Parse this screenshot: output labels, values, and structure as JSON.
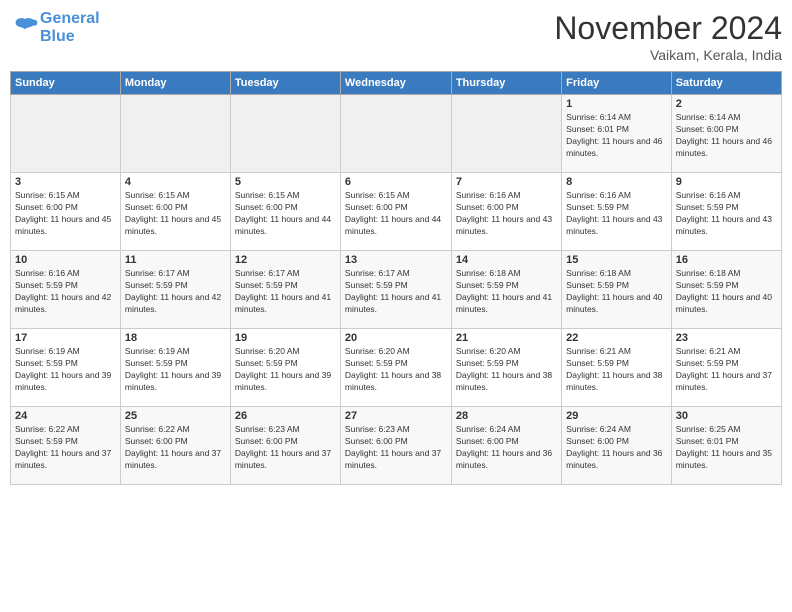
{
  "header": {
    "logo_general": "General",
    "logo_blue": "Blue",
    "title": "November 2024",
    "location": "Vaikam, Kerala, India"
  },
  "days_of_week": [
    "Sunday",
    "Monday",
    "Tuesday",
    "Wednesday",
    "Thursday",
    "Friday",
    "Saturday"
  ],
  "weeks": [
    [
      {
        "day": "",
        "info": ""
      },
      {
        "day": "",
        "info": ""
      },
      {
        "day": "",
        "info": ""
      },
      {
        "day": "",
        "info": ""
      },
      {
        "day": "",
        "info": ""
      },
      {
        "day": "1",
        "info": "Sunrise: 6:14 AM\nSunset: 6:01 PM\nDaylight: 11 hours and 46 minutes."
      },
      {
        "day": "2",
        "info": "Sunrise: 6:14 AM\nSunset: 6:00 PM\nDaylight: 11 hours and 46 minutes."
      }
    ],
    [
      {
        "day": "3",
        "info": "Sunrise: 6:15 AM\nSunset: 6:00 PM\nDaylight: 11 hours and 45 minutes."
      },
      {
        "day": "4",
        "info": "Sunrise: 6:15 AM\nSunset: 6:00 PM\nDaylight: 11 hours and 45 minutes."
      },
      {
        "day": "5",
        "info": "Sunrise: 6:15 AM\nSunset: 6:00 PM\nDaylight: 11 hours and 44 minutes."
      },
      {
        "day": "6",
        "info": "Sunrise: 6:15 AM\nSunset: 6:00 PM\nDaylight: 11 hours and 44 minutes."
      },
      {
        "day": "7",
        "info": "Sunrise: 6:16 AM\nSunset: 6:00 PM\nDaylight: 11 hours and 43 minutes."
      },
      {
        "day": "8",
        "info": "Sunrise: 6:16 AM\nSunset: 5:59 PM\nDaylight: 11 hours and 43 minutes."
      },
      {
        "day": "9",
        "info": "Sunrise: 6:16 AM\nSunset: 5:59 PM\nDaylight: 11 hours and 43 minutes."
      }
    ],
    [
      {
        "day": "10",
        "info": "Sunrise: 6:16 AM\nSunset: 5:59 PM\nDaylight: 11 hours and 42 minutes."
      },
      {
        "day": "11",
        "info": "Sunrise: 6:17 AM\nSunset: 5:59 PM\nDaylight: 11 hours and 42 minutes."
      },
      {
        "day": "12",
        "info": "Sunrise: 6:17 AM\nSunset: 5:59 PM\nDaylight: 11 hours and 41 minutes."
      },
      {
        "day": "13",
        "info": "Sunrise: 6:17 AM\nSunset: 5:59 PM\nDaylight: 11 hours and 41 minutes."
      },
      {
        "day": "14",
        "info": "Sunrise: 6:18 AM\nSunset: 5:59 PM\nDaylight: 11 hours and 41 minutes."
      },
      {
        "day": "15",
        "info": "Sunrise: 6:18 AM\nSunset: 5:59 PM\nDaylight: 11 hours and 40 minutes."
      },
      {
        "day": "16",
        "info": "Sunrise: 6:18 AM\nSunset: 5:59 PM\nDaylight: 11 hours and 40 minutes."
      }
    ],
    [
      {
        "day": "17",
        "info": "Sunrise: 6:19 AM\nSunset: 5:59 PM\nDaylight: 11 hours and 39 minutes."
      },
      {
        "day": "18",
        "info": "Sunrise: 6:19 AM\nSunset: 5:59 PM\nDaylight: 11 hours and 39 minutes."
      },
      {
        "day": "19",
        "info": "Sunrise: 6:20 AM\nSunset: 5:59 PM\nDaylight: 11 hours and 39 minutes."
      },
      {
        "day": "20",
        "info": "Sunrise: 6:20 AM\nSunset: 5:59 PM\nDaylight: 11 hours and 38 minutes."
      },
      {
        "day": "21",
        "info": "Sunrise: 6:20 AM\nSunset: 5:59 PM\nDaylight: 11 hours and 38 minutes."
      },
      {
        "day": "22",
        "info": "Sunrise: 6:21 AM\nSunset: 5:59 PM\nDaylight: 11 hours and 38 minutes."
      },
      {
        "day": "23",
        "info": "Sunrise: 6:21 AM\nSunset: 5:59 PM\nDaylight: 11 hours and 37 minutes."
      }
    ],
    [
      {
        "day": "24",
        "info": "Sunrise: 6:22 AM\nSunset: 5:59 PM\nDaylight: 11 hours and 37 minutes."
      },
      {
        "day": "25",
        "info": "Sunrise: 6:22 AM\nSunset: 6:00 PM\nDaylight: 11 hours and 37 minutes."
      },
      {
        "day": "26",
        "info": "Sunrise: 6:23 AM\nSunset: 6:00 PM\nDaylight: 11 hours and 37 minutes."
      },
      {
        "day": "27",
        "info": "Sunrise: 6:23 AM\nSunset: 6:00 PM\nDaylight: 11 hours and 37 minutes."
      },
      {
        "day": "28",
        "info": "Sunrise: 6:24 AM\nSunset: 6:00 PM\nDaylight: 11 hours and 36 minutes."
      },
      {
        "day": "29",
        "info": "Sunrise: 6:24 AM\nSunset: 6:00 PM\nDaylight: 11 hours and 36 minutes."
      },
      {
        "day": "30",
        "info": "Sunrise: 6:25 AM\nSunset: 6:01 PM\nDaylight: 11 hours and 35 minutes."
      }
    ]
  ]
}
